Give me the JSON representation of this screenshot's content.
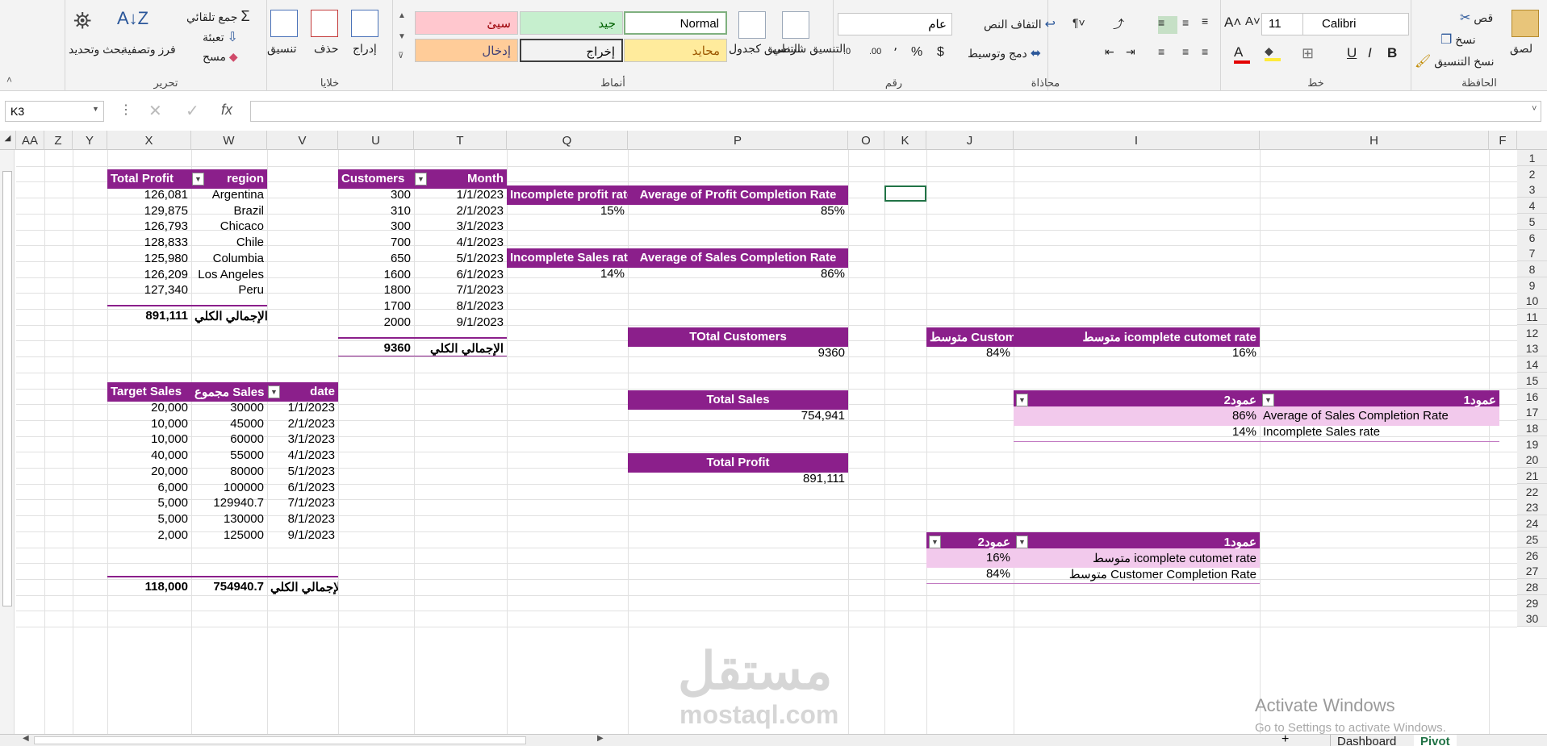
{
  "ribbon": {
    "clipboard": {
      "label": "الحافظة",
      "paste": "لصق",
      "cut": "قص",
      "copy": "نسخ",
      "format_painter": "نسخ التنسيق"
    },
    "font": {
      "label": "خط",
      "name": "Calibri",
      "size": "11",
      "bold": "B",
      "italic": "I",
      "underline": "U"
    },
    "alignment": {
      "label": "محاذاة",
      "wrap_text": "التفاف النص",
      "merge_center": "دمج وتوسيط"
    },
    "number": {
      "label": "رقم",
      "format": "عام",
      "currency": "$",
      "percent": "%",
      "comma": "٬"
    },
    "styles": {
      "label": "أنماط",
      "conditional": "التنسيق شرطي",
      "as_table": "التنسيق كجدول",
      "cells": [
        "Normal",
        "جيد",
        "سيئ",
        "محايد",
        "إخراج",
        "إدخال"
      ]
    },
    "cells_group": {
      "label": "خلايا",
      "insert": "إدراج",
      "delete": "حذف",
      "format": "تنسيق"
    },
    "editing": {
      "label": "تحرير",
      "autosum": "جمع تلقائي",
      "fill": "تعبئة",
      "clear": "مسح",
      "sort_filter": "فرز وتصفية",
      "find_select": "بحث وتحديد"
    }
  },
  "formula_bar": {
    "name_box": "K3",
    "fx": "fx",
    "formula": ""
  },
  "columns": [
    "F",
    "H",
    "I",
    "J",
    "K",
    "O",
    "P",
    "Q",
    "T",
    "U",
    "V",
    "W",
    "X",
    "Y",
    "Z",
    "AA"
  ],
  "rows": [
    "1",
    "2",
    "3",
    "4",
    "5",
    "6",
    "7",
    "8",
    "9",
    "10",
    "11",
    "12",
    "13",
    "14",
    "15",
    "16",
    "17",
    "18",
    "19",
    "20",
    "21",
    "22",
    "23",
    "24",
    "25",
    "26",
    "27",
    "28",
    "29",
    "30"
  ],
  "region_table": {
    "headers": {
      "region": "region",
      "profit": "Total Profit"
    },
    "rows": [
      {
        "region": "Argentina",
        "profit": "126,081"
      },
      {
        "region": "Brazil",
        "profit": "129,875"
      },
      {
        "region": "Chicaco",
        "profit": "126,793"
      },
      {
        "region": "Chile",
        "profit": "128,833"
      },
      {
        "region": "Columbia",
        "profit": "125,980"
      },
      {
        "region": "Los Angeles",
        "profit": "126,209"
      },
      {
        "region": "Peru",
        "profit": "127,340"
      }
    ],
    "total_label": "الإجمالي الكلي",
    "total": "891,111"
  },
  "month_table": {
    "headers": {
      "month": "Month",
      "customers": "Customers"
    },
    "rows": [
      {
        "month": "1/1/2023",
        "customers": "300"
      },
      {
        "month": "2/1/2023",
        "customers": "310"
      },
      {
        "month": "3/1/2023",
        "customers": "300"
      },
      {
        "month": "4/1/2023",
        "customers": "700"
      },
      {
        "month": "5/1/2023",
        "customers": "650"
      },
      {
        "month": "6/1/2023",
        "customers": "1600"
      },
      {
        "month": "7/1/2023",
        "customers": "1800"
      },
      {
        "month": "8/1/2023",
        "customers": "1700"
      },
      {
        "month": "9/1/2023",
        "customers": "2000"
      }
    ],
    "total_label": "الإجمالي الكلي",
    "total": "9360"
  },
  "sales_table": {
    "headers": {
      "date": "date",
      "sales": "مجموع Sales",
      "target": "Target Sales"
    },
    "rows": [
      {
        "date": "1/1/2023",
        "sales": "30000",
        "target": "20,000"
      },
      {
        "date": "2/1/2023",
        "sales": "45000",
        "target": "10,000"
      },
      {
        "date": "3/1/2023",
        "sales": "60000",
        "target": "10,000"
      },
      {
        "date": "4/1/2023",
        "sales": "55000",
        "target": "40,000"
      },
      {
        "date": "5/1/2023",
        "sales": "80000",
        "target": "20,000"
      },
      {
        "date": "6/1/2023",
        "sales": "100000",
        "target": "6,000"
      },
      {
        "date": "7/1/2023",
        "sales": "129940.7",
        "target": "5,000"
      },
      {
        "date": "8/1/2023",
        "sales": "130000",
        "target": "5,000"
      },
      {
        "date": "9/1/2023",
        "sales": "125000",
        "target": "2,000"
      }
    ],
    "total_label": "الإجمالي الكلي",
    "total_sales": "754940.7",
    "total_target": "118,000"
  },
  "kpis": {
    "avg_profit_label": "Average of Profit Completion Rate",
    "avg_profit": "85%",
    "incomplete_profit_label": "Incomplete profit rate",
    "incomplete_profit": "15%",
    "avg_sales_label": "Average of Sales Completion Rate",
    "avg_sales": "86%",
    "incomplete_sales_label": "Incomplete Sales rate",
    "incomplete_sales": "14%",
    "total_customers_label": "TOtal Customers",
    "total_customers": "9360",
    "total_sales_label": "Total Sales",
    "total_sales": "754,941",
    "total_profit_label": "Total Profit",
    "total_profit": "891,111"
  },
  "customer_rates": {
    "header_incomplete": "متوسط icomplete cutomet rate",
    "header_completion": "متوسط Customer Completion Rate",
    "incomplete": "16%",
    "completion": "84%"
  },
  "sales_rates_table": {
    "col1": "عمود1",
    "col2": "عمود2",
    "rows": [
      {
        "label": "Average of Sales Completion Rate",
        "value": "86%"
      },
      {
        "label": "Incomplete Sales rate",
        "value": "14%"
      }
    ]
  },
  "customer_rates_table": {
    "col1": "عمود1",
    "col2": "عمود2",
    "rows": [
      {
        "label": "متوسط icomplete cutomet rate",
        "value": "16%"
      },
      {
        "label": "متوسط Customer Completion Rate",
        "value": "84%"
      }
    ]
  },
  "sheets": {
    "tabs": [
      "Dashboard",
      "Pivot"
    ],
    "active": "Pivot",
    "add": "+"
  },
  "watermark": {
    "main": "مستقل",
    "sub": "mostaql.com"
  },
  "activation": {
    "title": "Activate Windows",
    "subtitle": "Go to Settings to activate Windows."
  },
  "colors": {
    "header": "#8b1f8b",
    "pink_row": "#f2c9ec",
    "selected_tab": "#217346"
  }
}
